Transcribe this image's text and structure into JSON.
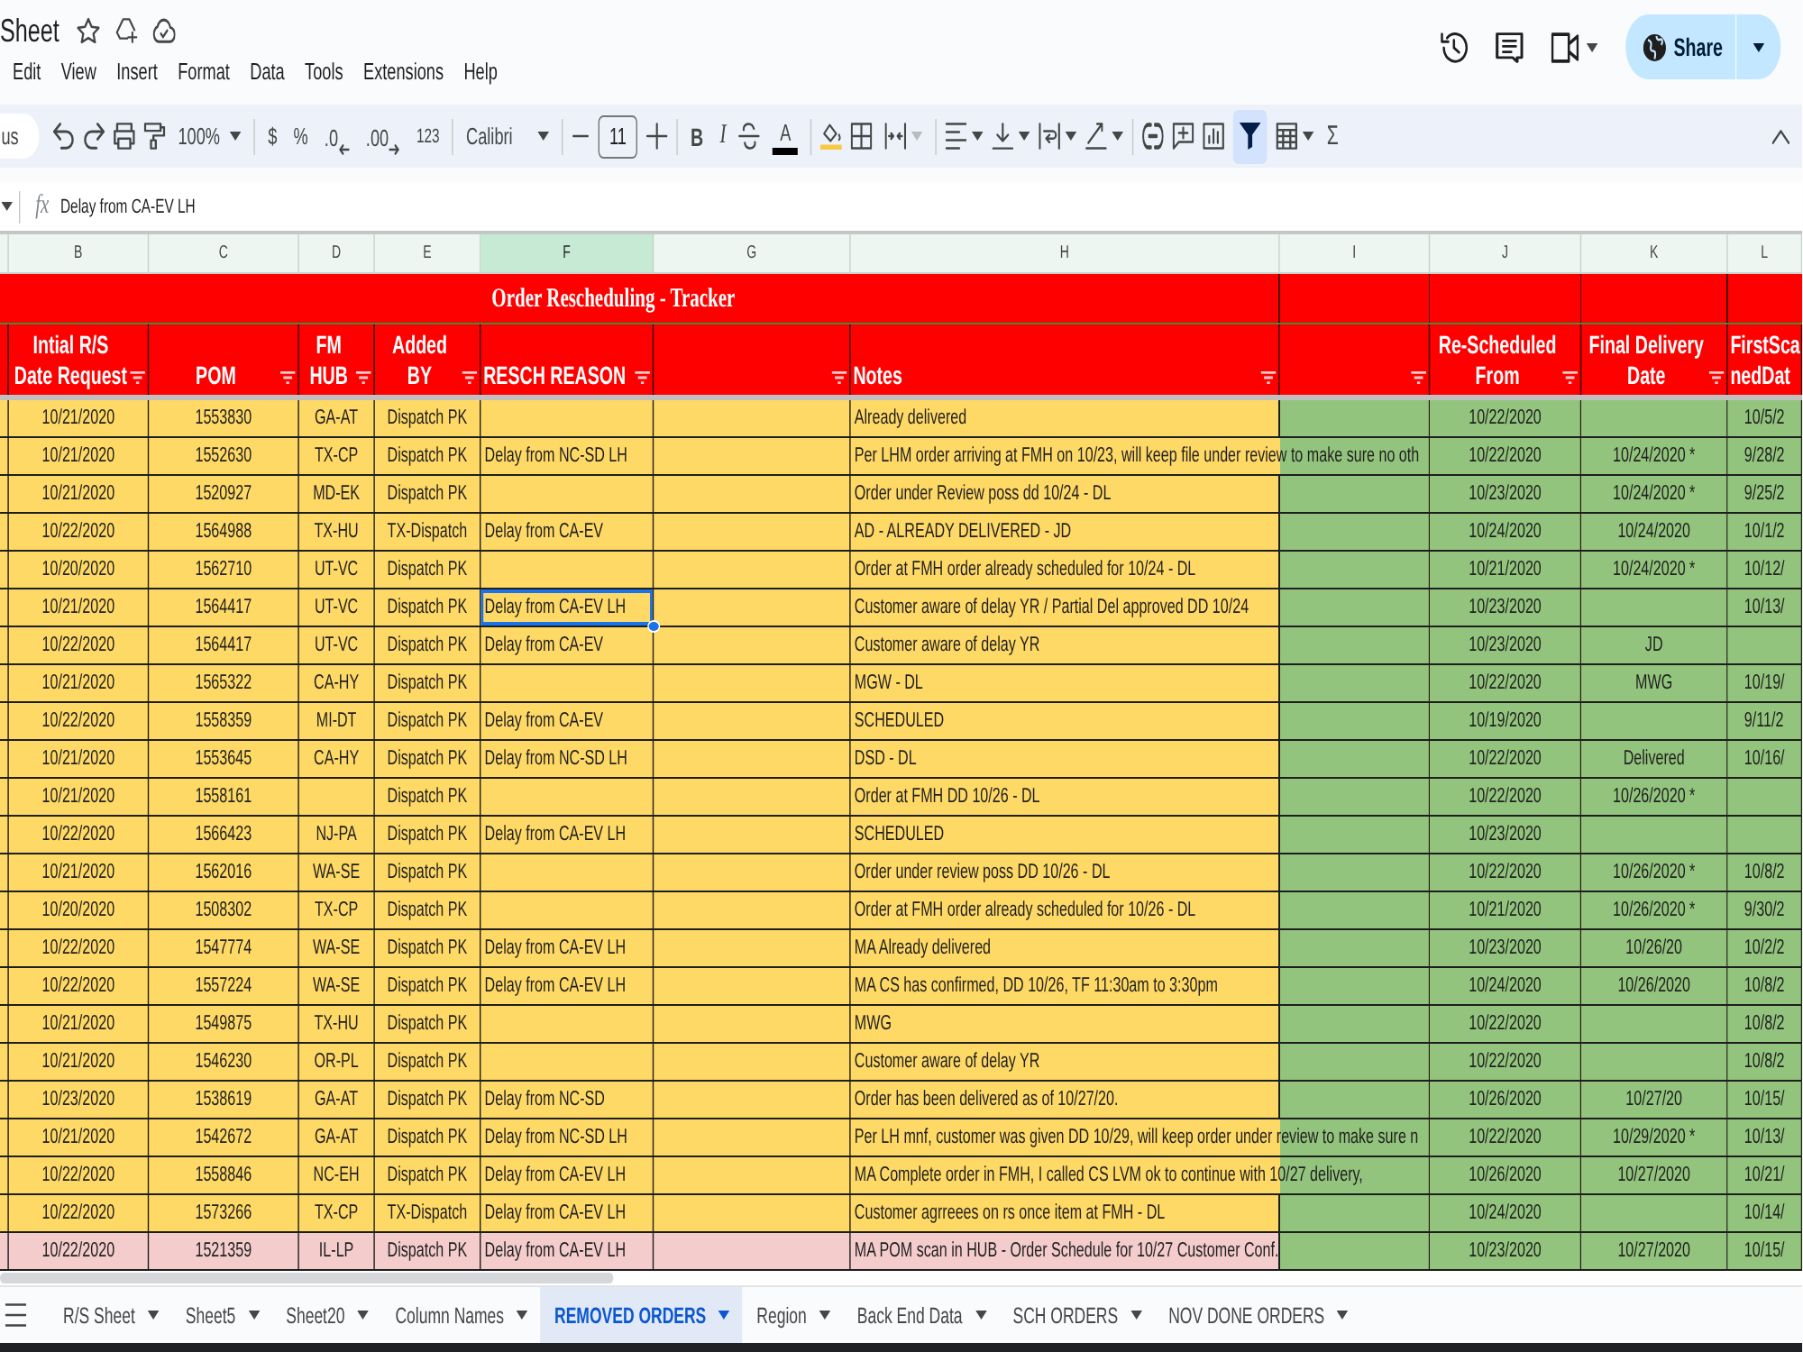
{
  "app": {
    "title": "Sheet",
    "share_label": "Share"
  },
  "menu": [
    "Edit",
    "View",
    "Insert",
    "Format",
    "Data",
    "Tools",
    "Extensions",
    "Help"
  ],
  "toolbar": {
    "search": "us",
    "zoom": "100%",
    "currency": "$",
    "percent": "%",
    "decrease_decimal": ".0",
    "increase_decimal": ".00",
    "number_format": "123",
    "font": "Calibri",
    "font_size": "11",
    "bold": "B",
    "italic": "I",
    "text_color": "A",
    "merge_disabled": true,
    "filter_on": true,
    "functions": "Σ"
  },
  "formula_bar": {
    "function_label": "fx",
    "value": "Delay from CA-EV LH"
  },
  "grid": {
    "columns": [
      {
        "letter": "B",
        "selected": false
      },
      {
        "letter": "C",
        "selected": false
      },
      {
        "letter": "D",
        "selected": false
      },
      {
        "letter": "E",
        "selected": false
      },
      {
        "letter": "F",
        "selected": true
      },
      {
        "letter": "G",
        "selected": false
      },
      {
        "letter": "H",
        "selected": false
      },
      {
        "letter": "I",
        "selected": false
      },
      {
        "letter": "J",
        "selected": false
      },
      {
        "letter": "K",
        "selected": false
      },
      {
        "letter": "L",
        "selected": false
      }
    ],
    "title": "Order Rescheduling - Tracker",
    "headers": [
      {
        "label": "Intial R/S\nDate Request",
        "filter": true
      },
      {
        "label": "POM",
        "filter": true
      },
      {
        "label": "FM\nHUB",
        "filter": true
      },
      {
        "label": "Added\nBY",
        "filter": true
      },
      {
        "label": "RESCH REASON",
        "filter": true
      },
      {
        "filter": true
      },
      {
        "label": "Notes",
        "filter": true
      },
      {
        "filter": true
      },
      {
        "label": "Re-Scheduled\nFrom",
        "filter": true
      },
      {
        "label": "Final Delivery\nDate",
        "filter": true
      },
      {
        "label": "FirstSca\nnedDat",
        "filter": false
      }
    ],
    "rows": [
      {
        "color": "#ffd966",
        "date_request": "10/21/2020",
        "pom": "1553830",
        "fm_hub": "GA-AT",
        "added_by": "Dispatch PK",
        "reason_selected": false,
        "notes": "Already delivered",
        "rescheduled_from": "10/22/2020",
        "column_l": "10/5/2"
      },
      {
        "color": "#ffd966",
        "date_request": "10/21/2020",
        "pom": "1552630",
        "fm_hub": "TX-CP",
        "added_by": "Dispatch PK",
        "resch_reason": "Delay from NC-SD LH",
        "reason_selected": false,
        "notes": "Per LHM order arriving at FMH on 10/23, will keep file under review to make sure no oth",
        "rescheduled_from": "10/22/2020",
        "final_delivery_date": "10/24/2020 *",
        "column_l": "9/28/2"
      },
      {
        "color": "#ffd966",
        "date_request": "10/21/2020",
        "pom": "1520927",
        "fm_hub": "MD-EK",
        "added_by": "Dispatch PK",
        "reason_selected": false,
        "notes": "Order under Review poss dd 10/24 - DL",
        "rescheduled_from": "10/23/2020",
        "final_delivery_date": "10/24/2020 *",
        "column_l": "9/25/2"
      },
      {
        "color": "#ffd966",
        "date_request": "10/22/2020",
        "pom": "1564988",
        "fm_hub": "TX-HU",
        "added_by": "TX-Dispatch",
        "resch_reason": "Delay from CA-EV",
        "reason_selected": false,
        "notes": "AD - ALREADY DELIVERED - JD",
        "rescheduled_from": "10/24/2020",
        "final_delivery_date": "10/24/2020",
        "column_l": "10/1/2"
      },
      {
        "color": "#ffd966",
        "date_request": "10/20/2020",
        "pom": "1562710",
        "fm_hub": "UT-VC",
        "added_by": "Dispatch PK",
        "reason_selected": false,
        "notes": "Order at FMH order already scheduled for 10/24 - DL",
        "rescheduled_from": "10/21/2020",
        "final_delivery_date": "10/24/2020 *",
        "column_l": "10/12/"
      },
      {
        "color": "#ffd966",
        "date_request": "10/21/2020",
        "pom": "1564417",
        "fm_hub": "UT-VC",
        "added_by": "Dispatch PK",
        "resch_reason": "Delay from CA-EV LH",
        "reason_selected": true,
        "notes": "Customer aware of delay YR / Partial Del approved DD 10/24",
        "rescheduled_from": "10/23/2020",
        "column_l": "10/13/"
      },
      {
        "color": "#ffd966",
        "date_request": "10/22/2020",
        "pom": "1564417",
        "fm_hub": "UT-VC",
        "added_by": "Dispatch PK",
        "resch_reason": "Delay from CA-EV",
        "reason_selected": false,
        "notes": "Customer aware of delay YR",
        "rescheduled_from": "10/23/2020",
        "final_delivery_date": "JD"
      },
      {
        "color": "#ffd966",
        "date_request": "10/21/2020",
        "pom": "1565322",
        "fm_hub": "CA-HY",
        "added_by": "Dispatch PK",
        "reason_selected": false,
        "notes": "MGW - DL",
        "rescheduled_from": "10/22/2020",
        "final_delivery_date": "MWG",
        "column_l": "10/19/"
      },
      {
        "color": "#ffd966",
        "date_request": "10/22/2020",
        "pom": "1558359",
        "fm_hub": "MI-DT",
        "added_by": "Dispatch PK",
        "resch_reason": "Delay from CA-EV",
        "reason_selected": false,
        "notes": "SCHEDULED",
        "rescheduled_from": "10/19/2020",
        "column_l": "9/11/2"
      },
      {
        "color": "#ffd966",
        "date_request": "10/21/2020",
        "pom": "1553645",
        "fm_hub": "CA-HY",
        "added_by": "Dispatch PK",
        "resch_reason": "Delay from NC-SD LH",
        "reason_selected": false,
        "notes": "DSD - DL",
        "rescheduled_from": "10/22/2020",
        "final_delivery_date": "Delivered",
        "column_l": "10/16/"
      },
      {
        "color": "#ffd966",
        "date_request": "10/21/2020",
        "pom": "1558161",
        "added_by": "Dispatch PK",
        "reason_selected": false,
        "notes": "Order at FMH DD 10/26 - DL",
        "rescheduled_from": "10/22/2020",
        "final_delivery_date": "10/26/2020 *"
      },
      {
        "color": "#ffd966",
        "date_request": "10/22/2020",
        "pom": "1566423",
        "fm_hub": "NJ-PA",
        "added_by": "Dispatch PK",
        "resch_reason": "Delay from CA-EV LH",
        "reason_selected": false,
        "notes": "SCHEDULED",
        "rescheduled_from": "10/23/2020"
      },
      {
        "color": "#ffd966",
        "date_request": "10/21/2020",
        "pom": "1562016",
        "fm_hub": "WA-SE",
        "added_by": "Dispatch PK",
        "reason_selected": false,
        "notes": "Order under review poss DD 10/26 - DL",
        "rescheduled_from": "10/22/2020",
        "final_delivery_date": "10/26/2020 *",
        "column_l": "10/8/2"
      },
      {
        "color": "#ffd966",
        "date_request": "10/20/2020",
        "pom": "1508302",
        "fm_hub": "TX-CP",
        "added_by": "Dispatch PK",
        "reason_selected": false,
        "notes": "Order at FMH order already scheduled for 10/26 - DL",
        "rescheduled_from": "10/21/2020",
        "final_delivery_date": "10/26/2020 *",
        "column_l": "9/30/2"
      },
      {
        "color": "#ffd966",
        "date_request": "10/22/2020",
        "pom": "1547774",
        "fm_hub": "WA-SE",
        "added_by": "Dispatch PK",
        "resch_reason": "Delay from CA-EV LH",
        "reason_selected": false,
        "notes": "MA Already delivered",
        "rescheduled_from": "10/23/2020",
        "final_delivery_date": "10/26/20",
        "column_l": "10/2/2"
      },
      {
        "color": "#ffd966",
        "date_request": "10/22/2020",
        "pom": "1557224",
        "fm_hub": "WA-SE",
        "added_by": "Dispatch PK",
        "resch_reason": "Delay from CA-EV LH",
        "reason_selected": false,
        "notes": "MA CS has confirmed, DD 10/26, TF 11:30am to 3:30pm",
        "rescheduled_from": "10/24/2020",
        "final_delivery_date": "10/26/2020",
        "column_l": "10/8/2"
      },
      {
        "color": "#ffd966",
        "date_request": "10/21/2020",
        "pom": "1549875",
        "fm_hub": "TX-HU",
        "added_by": "Dispatch PK",
        "reason_selected": false,
        "notes": "MWG",
        "rescheduled_from": "10/22/2020",
        "column_l": "10/8/2"
      },
      {
        "color": "#ffd966",
        "date_request": "10/21/2020",
        "pom": "1546230",
        "fm_hub": "OR-PL",
        "added_by": "Dispatch PK",
        "reason_selected": false,
        "notes": "Customer aware of delay YR",
        "rescheduled_from": "10/22/2020",
        "column_l": "10/8/2"
      },
      {
        "color": "#ffd966",
        "date_request": "10/23/2020",
        "pom": "1538619",
        "fm_hub": "GA-AT",
        "added_by": "Dispatch PK",
        "resch_reason": "Delay from NC-SD",
        "reason_selected": false,
        "notes": "Order has been delivered as of 10/27/20.",
        "rescheduled_from": "10/26/2020",
        "final_delivery_date": "10/27/20",
        "column_l": "10/15/"
      },
      {
        "color": "#ffd966",
        "date_request": "10/21/2020",
        "pom": "1542672",
        "fm_hub": "GA-AT",
        "added_by": "Dispatch PK",
        "resch_reason": "Delay from NC-SD LH",
        "reason_selected": false,
        "notes": "Per LH mnf, customer was given DD 10/29, will keep order under review to make sure n",
        "rescheduled_from": "10/22/2020",
        "final_delivery_date": "10/29/2020 *",
        "column_l": "10/13/"
      },
      {
        "color": "#ffd966",
        "date_request": "10/22/2020",
        "pom": "1558846",
        "fm_hub": "NC-EH",
        "added_by": "Dispatch PK",
        "resch_reason": "Delay from CA-EV LH",
        "reason_selected": false,
        "notes": "MA Complete order in FMH, I called CS LVM ok to continue with 10/27 delivery,",
        "rescheduled_from": "10/26/2020",
        "final_delivery_date": "10/27/2020",
        "column_l": "10/21/"
      },
      {
        "color": "#ffd966",
        "date_request": "10/22/2020",
        "pom": "1573266",
        "fm_hub": "TX-CP",
        "added_by": "TX-Dispatch",
        "resch_reason": "Delay from CA-EV LH",
        "reason_selected": false,
        "notes": "Customer agrreees on rs once item at FMH - DL",
        "rescheduled_from": "10/24/2020",
        "column_l": "10/14/"
      },
      {
        "color": "#f4cccc",
        "date_request": "10/22/2020",
        "pom": "1521359",
        "fm_hub": "IL-LP",
        "added_by": "Dispatch PK",
        "resch_reason": "Delay from CA-EV LH",
        "reason_selected": false,
        "notes": "MA POM scan in HUB - Order Schedule for 10/27 Customer Conf.",
        "rescheduled_from": "10/23/2020",
        "final_delivery_date": "10/27/2020",
        "column_l": "10/15/"
      }
    ]
  },
  "sheet_tabs": [
    {
      "label": "R/S Sheet",
      "selected": false
    },
    {
      "label": "Sheet5",
      "selected": false
    },
    {
      "label": "Sheet20",
      "selected": false
    },
    {
      "label": "Column Names",
      "selected": false
    },
    {
      "label": "REMOVED ORDERS",
      "selected": true
    },
    {
      "label": "Region",
      "selected": false
    },
    {
      "label": "Back End Data",
      "selected": false
    },
    {
      "label": "SCH ORDERS",
      "selected": false
    },
    {
      "label": "NOV DONE ORDERS",
      "selected": false
    }
  ]
}
